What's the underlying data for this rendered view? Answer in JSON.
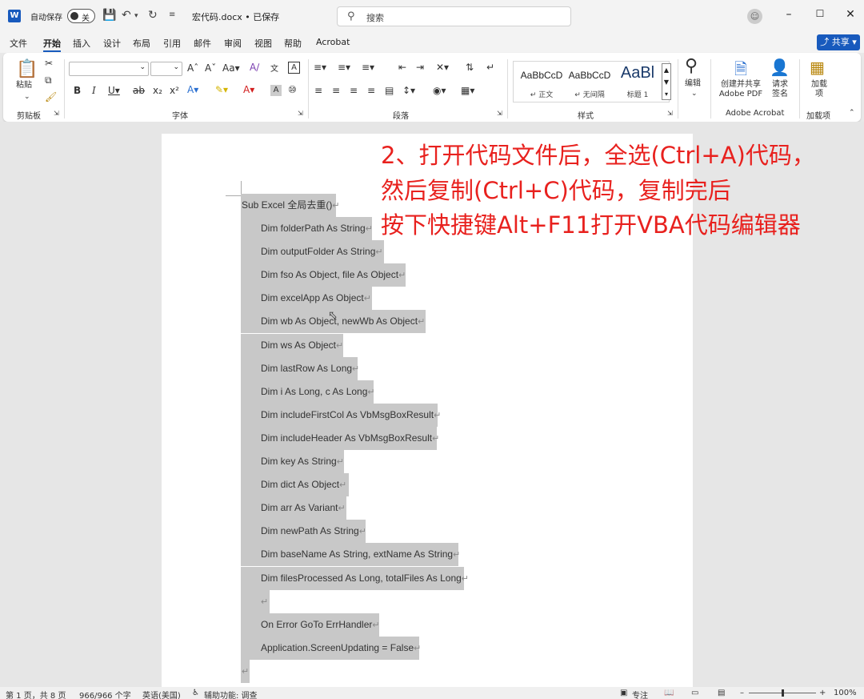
{
  "titlebar": {
    "app_icon": "W",
    "autosave_label": "自动保存",
    "autosave_state": "关",
    "doc_title": "宏代码.docx • 已保存",
    "search_placeholder": "搜索"
  },
  "menu": {
    "tabs": [
      "文件",
      "开始",
      "插入",
      "设计",
      "布局",
      "引用",
      "邮件",
      "审阅",
      "视图",
      "帮助",
      "Acrobat"
    ],
    "active": "开始",
    "share_label": "共享"
  },
  "ribbon": {
    "clipboard": {
      "paste_label": "粘贴",
      "group_label": "剪贴板"
    },
    "font": {
      "group_label": "字体"
    },
    "paragraph": {
      "group_label": "段落"
    },
    "styles": {
      "group_label": "样式",
      "items": [
        {
          "sample": "AaBbCcD",
          "name": "↵ 正文"
        },
        {
          "sample": "AaBbCcD",
          "name": "↵ 无间隔"
        },
        {
          "sample": "AaBl",
          "name": "标题 1"
        }
      ]
    },
    "editing": {
      "label": "编辑"
    },
    "acrobat": {
      "create_label": "创建并共享 Adobe PDF",
      "sign_label": "请求签名",
      "group_label": "Adobe Acrobat"
    },
    "addins": {
      "label": "加载项",
      "group_label": "加载项"
    }
  },
  "document": {
    "lines": [
      {
        "text": "Sub Excel 全局去重()",
        "indent": 0
      },
      {
        "text": "Dim folderPath As String",
        "indent": 1
      },
      {
        "text": "Dim outputFolder As String",
        "indent": 1
      },
      {
        "text": "Dim fso As Object, file As Object",
        "indent": 1
      },
      {
        "text": "Dim excelApp As Object",
        "indent": 1
      },
      {
        "text": "Dim wb As Object, newWb As Object",
        "indent": 1
      },
      {
        "text": "Dim ws As Object",
        "indent": 1
      },
      {
        "text": "Dim lastRow As Long",
        "indent": 1
      },
      {
        "text": "Dim i As Long, c As Long",
        "indent": 1
      },
      {
        "text": "Dim includeFirstCol As VbMsgBoxResult",
        "indent": 1
      },
      {
        "text": "Dim includeHeader As VbMsgBoxResult",
        "indent": 1
      },
      {
        "text": "Dim key As String",
        "indent": 1
      },
      {
        "text": "Dim dict As Object",
        "indent": 1
      },
      {
        "text": "Dim arr As Variant",
        "indent": 1
      },
      {
        "text": "Dim newPath As String",
        "indent": 1
      },
      {
        "text": "Dim baseName As String, extName As String",
        "indent": 1
      },
      {
        "text": "Dim filesProcessed As Long, totalFiles As Long",
        "indent": 1
      },
      {
        "text": "",
        "indent": 1
      },
      {
        "text": "On Error GoTo ErrHandler",
        "indent": 1
      },
      {
        "text": "Application.ScreenUpdating = False",
        "indent": 1
      },
      {
        "text": "",
        "indent": 0
      }
    ],
    "paragraph_mark": "↵"
  },
  "annotation": {
    "color": "#e8211e",
    "lines": [
      "2、打开代码文件后，全选(Ctrl+A)代码，",
      "然后复制(Ctrl+C)代码，复制完后",
      "按下快捷键Alt+F11打开VBA代码编辑器"
    ]
  },
  "statusbar": {
    "page": "第 1 页，共 8 页",
    "words": "966/966 个字",
    "language": "英语(美国)",
    "accessibility": "辅助功能: 调查",
    "focus": "专注",
    "zoom": "100%"
  }
}
